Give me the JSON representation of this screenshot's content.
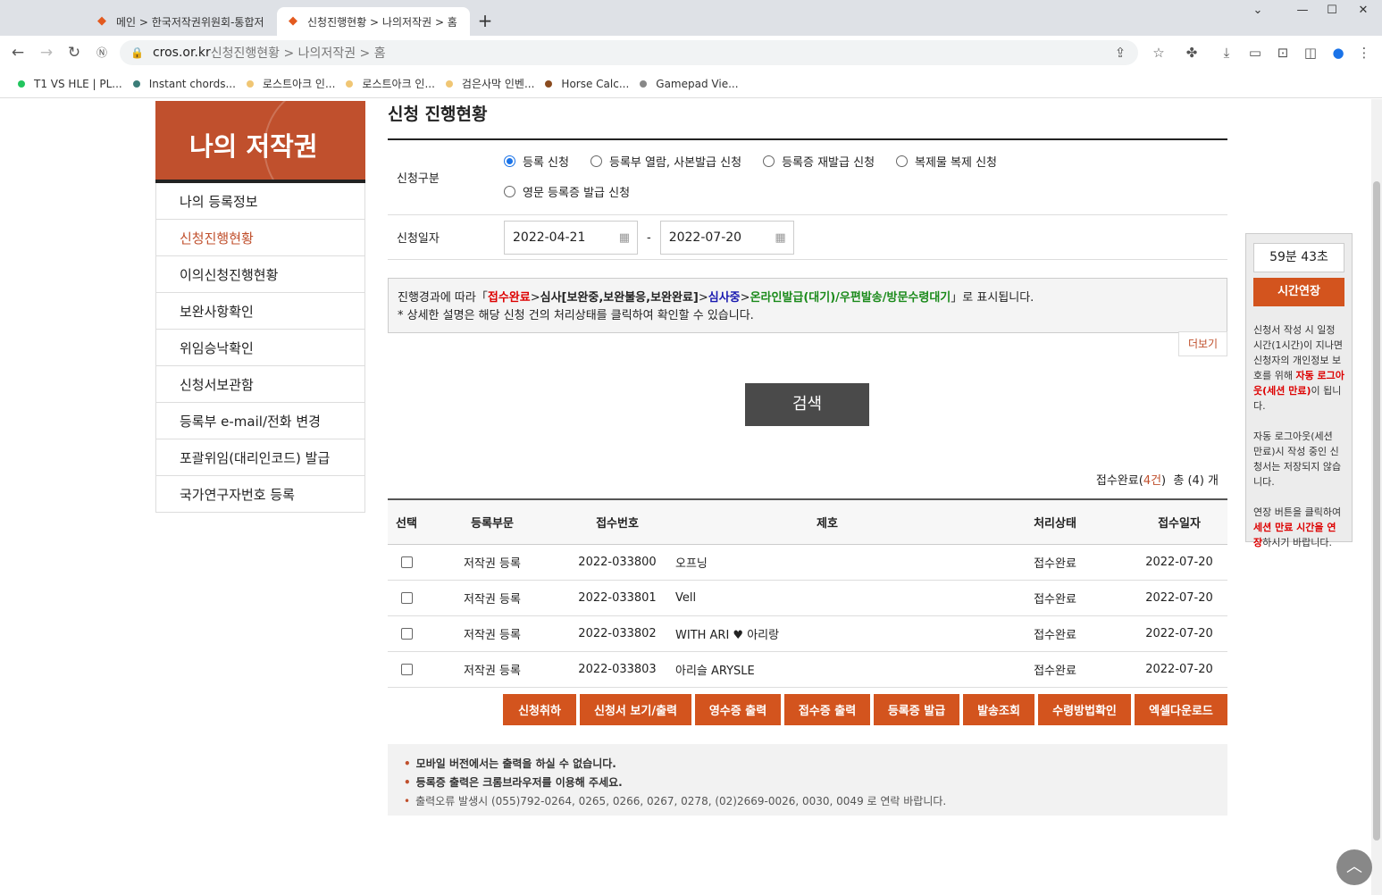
{
  "browser": {
    "tabs": [
      {
        "title": "메인 > 한국저작권위원회-통합저작권"
      },
      {
        "title": "신청진행현황 > 나의저작권 > 홈"
      }
    ],
    "new_tab": "+",
    "url_host": "cros.or.kr",
    "url_path": " 신청진행현황 > 나의저작권 > 홈",
    "bookmarks": [
      {
        "label": "T1 VS HLE | PL...",
        "color": "#22c55e"
      },
      {
        "label": "Instant chords...",
        "color": "#3b7d78"
      },
      {
        "label": "로스트아크 인...",
        "color": "#f0c674"
      },
      {
        "label": "로스트아크 인...",
        "color": "#f0c674"
      },
      {
        "label": "검은사막 인벤...",
        "color": "#f0c674"
      },
      {
        "label": "Horse Calc...",
        "color": "#8a4b1f"
      },
      {
        "label": "Gamepad Vie...",
        "color": "#888888"
      }
    ]
  },
  "sidebar": {
    "banner": "나의 저작권",
    "items": [
      {
        "label": "나의 등록정보"
      },
      {
        "label": "신청진행현황"
      },
      {
        "label": "이의신청진행현황"
      },
      {
        "label": "보완사항확인"
      },
      {
        "label": "위임승낙확인"
      },
      {
        "label": "신청서보관함"
      },
      {
        "label": "등록부 e-mail/전화 변경"
      },
      {
        "label": "포괄위임(대리인코드) 발급"
      },
      {
        "label": "국가연구자번호 등록"
      }
    ]
  },
  "main": {
    "title": "신청 진행현황",
    "type_label": "신청구분",
    "types": [
      {
        "label": "등록 신청",
        "checked": true
      },
      {
        "label": "등록부 열람, 사본발급 신청",
        "checked": false
      },
      {
        "label": "등록증 재발급 신청",
        "checked": false
      },
      {
        "label": "복제물 복제 신청",
        "checked": false
      },
      {
        "label": "영문 등록증 발급 신청",
        "checked": false
      }
    ],
    "date_label": "신청일자",
    "date_from": "2022-04-21",
    "date_to": "2022-07-20",
    "date_sep": "-",
    "info": {
      "p1": "진행경과에 따라「",
      "s1": "접수완료",
      "gt1": ">",
      "s2": "심사[보완중,보완불응,보완완료]",
      "gt2": ">",
      "s3": "심사중",
      "gt3": ">",
      "s4": "온라인발급(대기)/우편발송/방문수령대기",
      "p2": "」로 표시됩니다.",
      "line2": "* 상세한 설명은 해당 신청 건의 처리상태를 클릭하여 확인할 수 있습니다."
    },
    "more": "더보기",
    "search": "검색",
    "count": {
      "label": "접수완료(",
      "num": "4건",
      "close": ")",
      "total": "총 (4) 개"
    },
    "table": {
      "headers": [
        "선택",
        "등록부문",
        "접수번호",
        "제호",
        "처리상태",
        "접수일자"
      ],
      "rows": [
        {
          "section": "저작권 등록",
          "no": "2022-033800",
          "title": "오프닝",
          "status": "접수완료",
          "date": "2022-07-20"
        },
        {
          "section": "저작권 등록",
          "no": "2022-033801",
          "title": "Vell",
          "status": "접수완료",
          "date": "2022-07-20"
        },
        {
          "section": "저작권 등록",
          "no": "2022-033802",
          "title": "WITH ARI ♥ 아리랑",
          "status": "접수완료",
          "date": "2022-07-20"
        },
        {
          "section": "저작권 등록",
          "no": "2022-033803",
          "title": "아리슬 ARYSLE",
          "status": "접수완료",
          "date": "2022-07-20"
        }
      ]
    },
    "actions": [
      "신청취하",
      "신청서 보기/출력",
      "영수증 출력",
      "접수증 출력",
      "등록증 발급",
      "발송조회",
      "수령방법확인",
      "엑셀다운로드"
    ],
    "notices": [
      "모바일 버전에서는 출력을 하실 수 없습니다.",
      "등록증 출력은 크롬브라우저를 이용해 주세요.",
      "출력오류 발생시 (055)792-0264, 0265, 0266, 0267, 0278, (02)2669-0026, 0030, 0049 로 연락 바랍니다."
    ]
  },
  "timer": {
    "time": "59분 43초",
    "extend": "시간연장",
    "t1": "신청서 작성 시 일정 시간(1시간)이 지나면 신청자의 개인정보 보호를 위해 ",
    "t1r": "자동 로그아웃(세션 만료)",
    "t1e": "이 됩니다.",
    "t2": "자동 로그아웃(세션 만료)시 작성 중인 신청서는 저장되지 않습니다.",
    "t3": "연장 버튼을 클릭하여 ",
    "t3r": "세션 만료 시간을 연장",
    "t3e": "하시기 바랍니다."
  },
  "colors": {
    "accent": "#d3541e",
    "banner": "#c0502d"
  }
}
